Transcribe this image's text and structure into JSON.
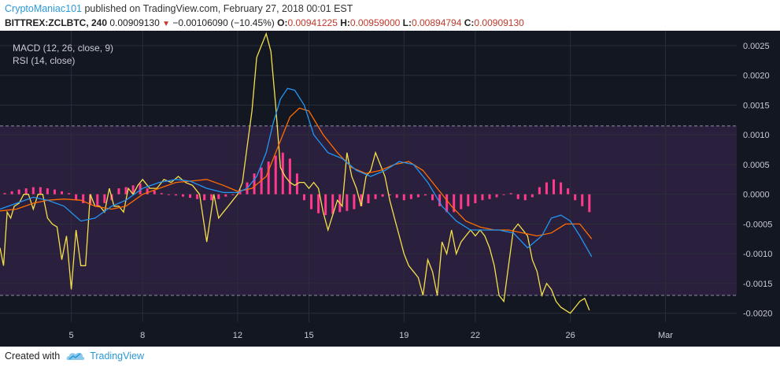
{
  "header": {
    "author": "CryptoManiac101",
    "published": " published on TradingView.com, February 27, 2018 00:01 EST",
    "symbol": "BITTREX:ZCLBTC, 240",
    "price": "0.00909130",
    "change": "−0.00106090 (−10.45%)",
    "o_label": "O:",
    "o_value": "0.00941225",
    "h_label": "H:",
    "h_value": "0.00959000",
    "l_label": "L:",
    "l_value": "0.00894794",
    "c_label": "C:",
    "c_value": "0.00909130"
  },
  "legend": {
    "macd": "MACD (12, 26, close, 9)",
    "rsi": "RSI (14, close)"
  },
  "footer": {
    "created_with": "Created with",
    "brand": "TradingView"
  },
  "colors": {
    "background": "#131722",
    "rsi_band": "#2a1f3d",
    "macd": "#2196f3",
    "signal": "#ff6d00",
    "histogram": "#ff3a8c",
    "rsi": "#f5e04a",
    "axis_text": "#c8cbd3",
    "accent": "#2a98d8",
    "down": "#c0392b"
  },
  "chart_data": {
    "type": "line",
    "y_axis": {
      "ticks": [
        0.0025,
        0.002,
        0.0015,
        0.001,
        0.0005,
        0.0,
        -0.0005,
        -0.001,
        -0.0015,
        -0.002
      ],
      "tick_labels": [
        "0.0025",
        "0.0020",
        "0.0015",
        "0.0010",
        "0.0005",
        "0.0000",
        "-0.0005",
        "-0.0010",
        "-0.0015",
        "-0.0020"
      ],
      "ylim": [
        -0.00215,
        0.00275
      ]
    },
    "x_axis": {
      "ticks": [
        5,
        8,
        12,
        15,
        19,
        22,
        26,
        30
      ],
      "tick_labels": [
        "5",
        "8",
        "12",
        "15",
        "19",
        "22",
        "26",
        "Mar"
      ],
      "xlim": [
        2,
        33
      ]
    },
    "rsi_band": {
      "upper": 70,
      "lower": 30
    },
    "macd": {
      "name": "MACD",
      "x": [
        2.0,
        2.7,
        3.4,
        4.0,
        4.7,
        5.4,
        6.0,
        6.7,
        7.3,
        8.0,
        8.7,
        9.4,
        10.0,
        10.7,
        11.4,
        12.0,
        12.4,
        12.8,
        13.2,
        13.5,
        13.8,
        14.1,
        14.4,
        14.8,
        15.2,
        15.8,
        16.4,
        17.0,
        17.6,
        18.2,
        18.8,
        19.4,
        20.0,
        20.6,
        21.2,
        21.8,
        22.4,
        23.0,
        23.6,
        24.2,
        24.8,
        25.2,
        25.6,
        26.0,
        26.4,
        26.9
      ],
      "values": [
        -0.00025,
        -0.00015,
        -5e-05,
        -0.0001,
        -0.0002,
        -0.00045,
        -0.0004,
        -0.0002,
        -0.0001,
        0.0001,
        0.0002,
        0.00025,
        0.00022,
        0.0001,
        3e-05,
        3e-05,
        0.0001,
        0.0003,
        0.0007,
        0.0012,
        0.0016,
        0.00178,
        0.00175,
        0.0015,
        0.001,
        0.0007,
        0.0006,
        0.0004,
        0.0003,
        0.0004,
        0.00055,
        0.0005,
        0.0002,
        -0.0002,
        -0.00045,
        -0.0006,
        -0.0006,
        -0.0006,
        -0.00065,
        -0.0009,
        -0.0007,
        -0.0004,
        -0.00035,
        -0.00045,
        -0.0007,
        -0.00105
      ]
    },
    "signal": {
      "name": "Signal",
      "x": [
        2.0,
        2.7,
        3.4,
        4.0,
        4.7,
        5.4,
        6.0,
        6.7,
        7.3,
        8.0,
        8.7,
        9.4,
        10.0,
        10.7,
        11.4,
        12.0,
        12.6,
        13.2,
        13.8,
        14.2,
        14.6,
        15.0,
        15.6,
        16.2,
        16.8,
        17.4,
        18.0,
        18.6,
        19.2,
        19.8,
        20.4,
        21.0,
        21.6,
        22.2,
        22.8,
        23.4,
        24.0,
        24.6,
        25.2,
        25.8,
        26.4,
        26.9
      ],
      "values": [
        -0.00028,
        -0.00025,
        -0.00015,
        -0.0001,
        -8e-05,
        -0.0001,
        -0.0002,
        -0.00025,
        -0.0002,
        0.0,
        0.0001,
        0.0002,
        0.00022,
        0.00025,
        0.00015,
        5e-05,
        0.0001,
        0.0003,
        0.0009,
        0.0013,
        0.00145,
        0.0014,
        0.001,
        0.0007,
        0.00045,
        0.00035,
        0.0004,
        0.0005,
        0.00055,
        0.0004,
        0.0001,
        -0.0002,
        -0.00045,
        -0.00055,
        -0.0006,
        -0.0006,
        -0.00065,
        -0.0007,
        -0.00065,
        -0.0005,
        -0.0005,
        -0.00075
      ]
    },
    "histogram": {
      "name": "Histogram",
      "x": [
        2.2,
        2.5,
        2.8,
        3.1,
        3.4,
        3.7,
        4.0,
        4.3,
        4.6,
        4.9,
        5.2,
        5.5,
        5.8,
        6.1,
        6.4,
        6.7,
        7.0,
        7.3,
        7.6,
        7.9,
        8.2,
        8.5,
        8.8,
        9.1,
        9.4,
        9.7,
        10.0,
        10.3,
        10.6,
        10.9,
        11.2,
        11.5,
        11.8,
        12.1,
        12.4,
        12.7,
        13.0,
        13.3,
        13.6,
        13.9,
        14.2,
        14.5,
        14.8,
        15.1,
        15.4,
        15.7,
        16.0,
        16.3,
        16.6,
        16.9,
        17.2,
        17.5,
        17.8,
        18.1,
        18.4,
        18.7,
        19.0,
        19.3,
        19.6,
        19.9,
        20.2,
        20.5,
        20.8,
        21.1,
        21.4,
        21.7,
        22.0,
        22.3,
        22.6,
        22.9,
        23.2,
        23.5,
        23.8,
        24.1,
        24.4,
        24.7,
        25.0,
        25.3,
        25.6,
        25.9,
        26.2,
        26.5,
        26.8
      ],
      "values": [
        2e-05,
        5e-05,
        8e-05,
        0.0001,
        0.00012,
        0.00012,
        0.0001,
        8e-05,
        5e-05,
        2e-05,
        -0.0001,
        -0.00015,
        -0.00018,
        -0.0002,
        -0.00015,
        -0.0001,
        0.0001,
        0.00012,
        0.00015,
        0.00018,
        0.0001,
        6e-05,
        2e-05,
        0.0,
        -2e-05,
        -4e-05,
        -6e-05,
        -8e-05,
        -0.0001,
        -0.0001,
        -8e-05,
        -4e-05,
        0.0,
        8e-05,
        0.0002,
        0.00035,
        0.00045,
        0.00055,
        0.00065,
        0.0007,
        0.0006,
        0.00035,
        -0.0001,
        -0.00025,
        -0.00032,
        -0.00035,
        -0.00033,
        -0.0003,
        -0.00028,
        -0.00025,
        -0.0002,
        -0.00015,
        -8e-05,
        -4e-05,
        -2e-05,
        -6e-05,
        -0.0001,
        -8e-05,
        -5e-05,
        -2e-05,
        -0.0001,
        -0.0002,
        -0.0003,
        -0.0003,
        -0.00025,
        -0.0002,
        -0.00015,
        -0.0001,
        -8e-05,
        -5e-05,
        0.0,
        2e-05,
        -8e-05,
        -0.0001,
        -5e-05,
        0.00012,
        0.0002,
        0.00025,
        0.0002,
        0.0001,
        -0.0001,
        -0.0002,
        -0.0003
      ]
    },
    "rsi": {
      "name": "RSI",
      "x": [
        2.0,
        2.15,
        2.3,
        2.45,
        2.6,
        2.8,
        3.0,
        3.2,
        3.4,
        3.6,
        3.8,
        4.0,
        4.2,
        4.4,
        4.6,
        4.8,
        5.0,
        5.2,
        5.4,
        5.6,
        5.8,
        6.0,
        6.2,
        6.4,
        6.6,
        6.8,
        7.0,
        7.2,
        7.4,
        7.6,
        7.8,
        8.0,
        8.3,
        8.6,
        8.9,
        9.2,
        9.5,
        9.8,
        10.1,
        10.4,
        10.7,
        11.0,
        11.2,
        11.4,
        11.6,
        11.8,
        12.0,
        12.2,
        12.4,
        12.6,
        12.8,
        13.0,
        13.2,
        13.4,
        13.6,
        13.8,
        14.0,
        14.2,
        14.4,
        14.6,
        14.8,
        15.0,
        15.2,
        15.4,
        15.6,
        15.8,
        16.0,
        16.2,
        16.4,
        16.6,
        16.8,
        17.0,
        17.2,
        17.4,
        17.6,
        17.8,
        18.0,
        18.2,
        18.4,
        18.6,
        18.8,
        19.0,
        19.2,
        19.4,
        19.6,
        19.8,
        20.0,
        20.2,
        20.4,
        20.6,
        20.8,
        21.0,
        21.2,
        21.4,
        21.6,
        21.8,
        22.0,
        22.2,
        22.4,
        22.6,
        22.8,
        23.0,
        23.2,
        23.4,
        23.6,
        23.8,
        24.0,
        24.2,
        24.4,
        24.6,
        24.8,
        25.0,
        25.2,
        25.4,
        25.6,
        25.8,
        26.0,
        26.2,
        26.4,
        26.6,
        26.8
      ],
      "values": [
        -0.0009,
        -0.0012,
        -0.0003,
        -0.0004,
        -0.0002,
        -0.00015,
        0.0,
        0.0,
        -0.00025,
        0.0,
        0.0,
        -0.0004,
        -0.0005,
        -0.00055,
        -0.0011,
        -0.0007,
        -0.0016,
        -0.0006,
        -0.0012,
        -0.0012,
        0.0,
        -0.0002,
        -0.0002,
        -0.0003,
        0.0001,
        -0.0002,
        -0.0002,
        -0.0003,
        0.0001,
        0.0,
        0.00015,
        0.00025,
        0.0001,
        0.0001,
        0.00025,
        0.0002,
        0.0003,
        0.0002,
        0.00015,
        0.0,
        -0.0008,
        0.0,
        -0.0004,
        -0.0003,
        -0.0002,
        -0.0001,
        0.0,
        0.0002,
        0.0008,
        0.0014,
        0.0023,
        0.0025,
        0.0027,
        0.0024,
        0.0015,
        0.00045,
        0.0003,
        0.0002,
        0.00015,
        0.0002,
        0.0002,
        0.0001,
        0.0002,
        0.0001,
        -0.0003,
        -0.0006,
        -0.00035,
        -0.0001,
        -0.0002,
        0.0007,
        0.0003,
        0.0001,
        -0.0002,
        0.0003,
        0.0004,
        0.0007,
        0.0005,
        0.0003,
        -0.0001,
        -0.0004,
        -0.0007,
        -0.001,
        -0.0012,
        -0.0013,
        -0.0014,
        -0.0017,
        -0.0011,
        -0.0013,
        -0.0017,
        -0.0008,
        -0.001,
        -0.0006,
        -0.001,
        -0.0008,
        -0.0007,
        -0.0006,
        -0.0007,
        -0.0006,
        -0.0007,
        -0.0009,
        -0.0012,
        -0.0017,
        -0.0018,
        -0.0012,
        -0.0006,
        -0.0005,
        -0.0006,
        -0.0007,
        -0.0011,
        -0.0013,
        -0.0017,
        -0.0015,
        -0.0016,
        -0.0018,
        -0.0019,
        -0.00195,
        -0.002,
        -0.0019,
        -0.0018,
        -0.00175,
        -0.00195
      ]
    }
  }
}
